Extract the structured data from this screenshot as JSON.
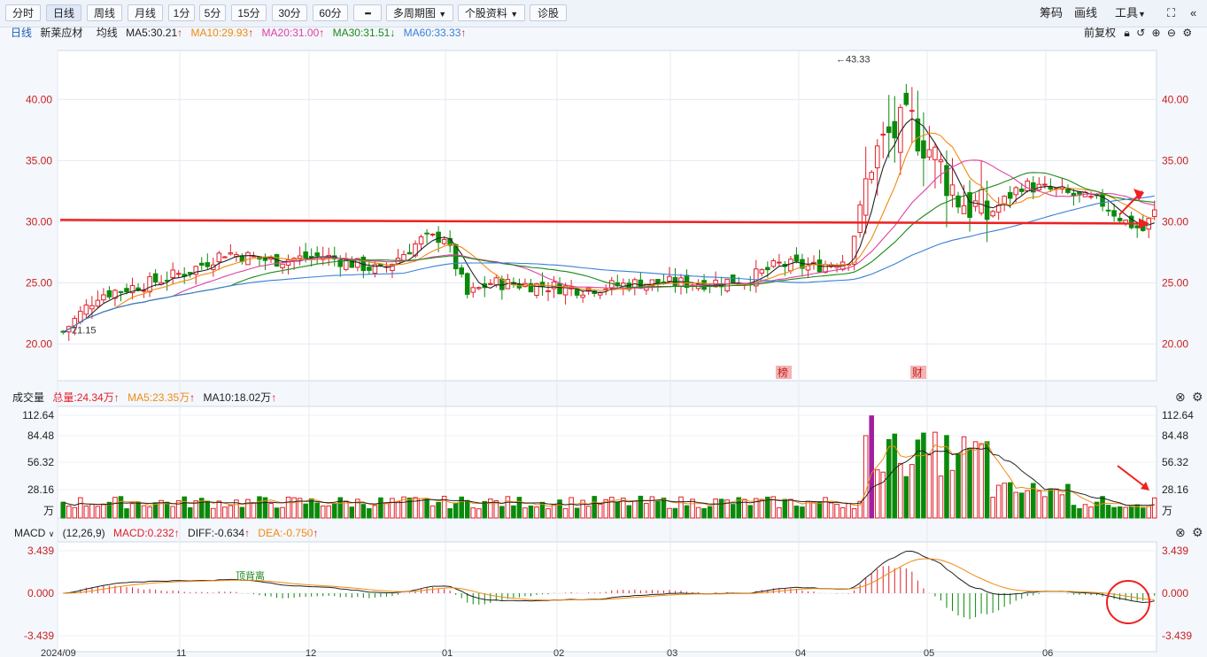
{
  "toolbar": {
    "buttons": [
      "分时",
      "日线",
      "周线",
      "月线",
      "1分",
      "5分",
      "15分",
      "30分",
      "60分",
      "▪▪▪",
      "多周期图",
      "个股资料",
      "诊股"
    ],
    "active": "日线",
    "right": [
      "筹码",
      "画线",
      "工具"
    ]
  },
  "main_legend": {
    "period": "日线",
    "stock_name": "新莱应材",
    "ma_label": "均线",
    "ma5": "MA5:30.21",
    "ma10": "MA10:29.93",
    "ma20": "MA20:31.00",
    "ma30": "MA30:31.51",
    "ma60": "MA60:33.33",
    "adjust": "前复权"
  },
  "volume_legend": {
    "title": "成交量",
    "total": "总量:24.34万",
    "ma5": "MA5:23.35万",
    "ma10": "MA10:18.02万"
  },
  "macd_legend": {
    "title": "MACD",
    "params": "(12,26,9)",
    "macd": "MACD:0.232",
    "diff": "DIFF:-0.634",
    "dea": "DEA:-0.750"
  },
  "colors": {
    "up": "#e0202a",
    "down": "#0a8a0a",
    "ma5": "#222222",
    "ma10": "#f08a10",
    "ma20": "#e040a0",
    "ma30": "#1a8a1a",
    "ma60": "#3a7fd8",
    "annotation": "#f02020"
  },
  "chart_data": [
    {
      "type": "candlestick",
      "title": "日线 新莱应材",
      "ylim": [
        17,
        44
      ],
      "y_ticks": [
        "40.00",
        "35.00",
        "30.00",
        "25.00",
        "20.00"
      ],
      "x_ticks": [
        "2024/09",
        "11",
        "12",
        "01",
        "02",
        "03",
        "04",
        "05",
        "06"
      ],
      "annotations": {
        "high_label": "43.33",
        "low_label": "21.15",
        "event_markers": [
          "榜",
          "财"
        ]
      },
      "support_level": 30.0,
      "ma_values": {
        "MA5": 30.21,
        "MA10": 29.93,
        "MA20": 31.0,
        "MA30": 31.51,
        "MA60": 33.33
      }
    },
    {
      "type": "bar",
      "title": "成交量",
      "y_ticks": [
        "112.64",
        "84.48",
        "56.32",
        "28.16",
        "万"
      ]
    },
    {
      "type": "bar",
      "title": "MACD",
      "y_ticks": [
        "3.439",
        "0.000",
        "-3.439"
      ],
      "values": {
        "MACD": 0.232,
        "DIFF": -0.634,
        "DEA": -0.75
      },
      "annotation_text": "顶背离"
    }
  ]
}
